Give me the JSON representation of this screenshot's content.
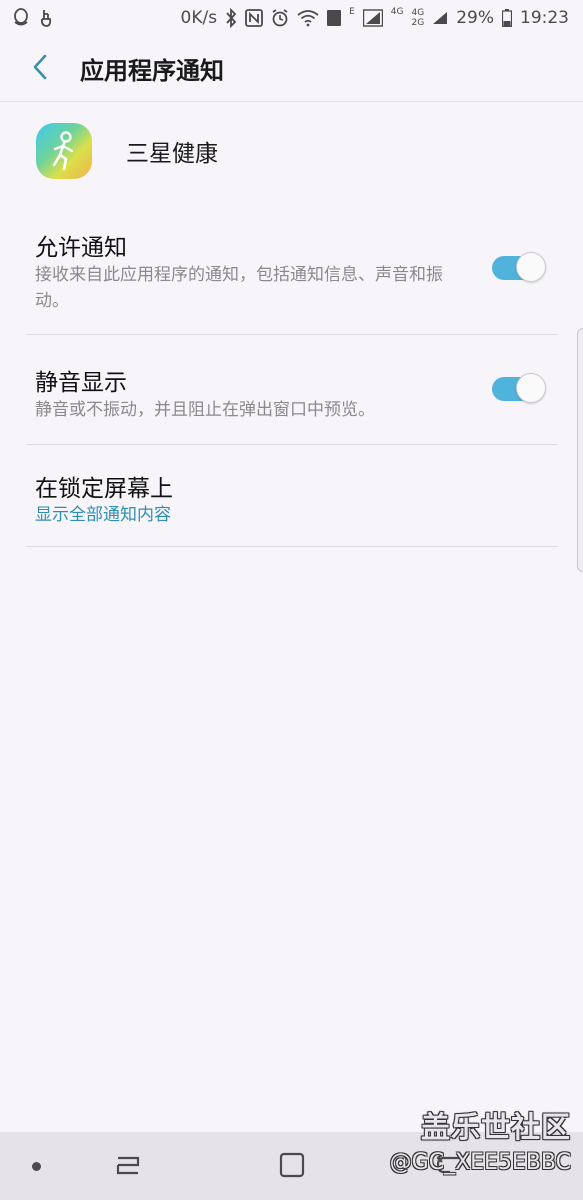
{
  "status_bar": {
    "network_speed": "0K/s",
    "battery": "29%",
    "time": "19:23",
    "signal_label_1": "4G",
    "signal_label_2a": "4G",
    "signal_label_2b": "2G",
    "data_type": "E",
    "sim_slot": "1",
    "icons": [
      "qq-icon",
      "hand-icon",
      "bluetooth-icon",
      "nfc-icon",
      "alarm-icon",
      "wifi-icon",
      "sim-icon",
      "signal-icon",
      "battery-icon"
    ]
  },
  "header": {
    "title": "应用程序通知",
    "back_icon": "chevron-left-icon"
  },
  "app": {
    "name": "三星健康",
    "icon": "samsung-health-icon"
  },
  "settings": {
    "allow": {
      "title": "允许通知",
      "subtitle": "接收来自此应用程序的通知，包括通知信息、声音和振动。",
      "enabled": true
    },
    "mute": {
      "title": "静音显示",
      "subtitle": "静音或不振动，并且阻止在弹出窗口中预览。",
      "enabled": true
    },
    "lock": {
      "title": "在锁定屏幕上",
      "subtitle": "显示全部通知内容"
    }
  },
  "colors": {
    "accent": "#2e8fb0",
    "toggle_on": "#4fb3dc",
    "background": "#f7f5fa"
  },
  "watermark": {
    "logo": "盖乐世社区",
    "handle": "@GC_XEE5EBBC"
  }
}
